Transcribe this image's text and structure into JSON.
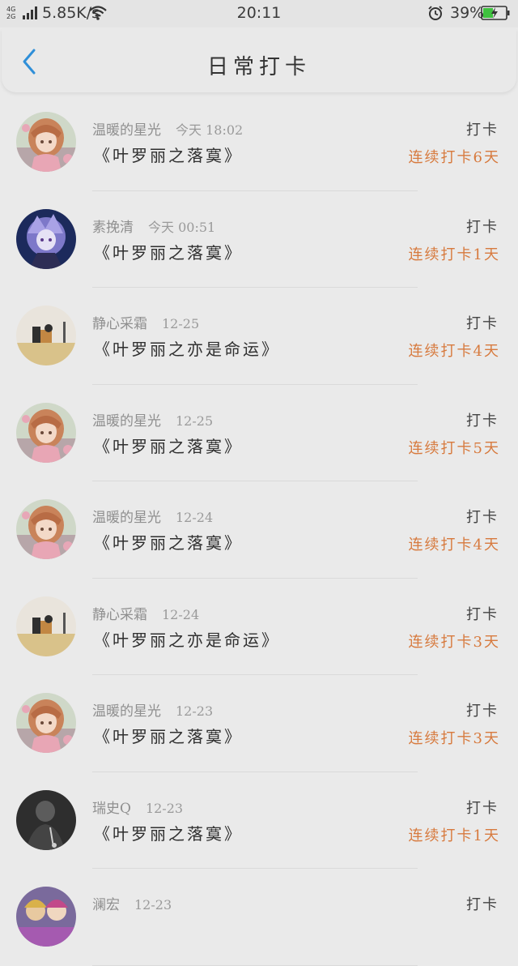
{
  "status_bar": {
    "network_top": "4G",
    "network_bottom": "2G",
    "speed": "5.85K/s",
    "time": "20:11",
    "battery": "39%"
  },
  "header": {
    "title": "日常打卡",
    "back_icon": "chevron-left-icon"
  },
  "colors": {
    "accent": "#2f8fd8",
    "streak": "#d77a3e"
  },
  "entries": [
    {
      "name": "温暖的星光",
      "date": "今天 18:02",
      "book": "《叶罗丽之落寞》",
      "checkin": "打卡",
      "streak": "连续打卡6天",
      "avatar": "anime-girl-pink"
    },
    {
      "name": "素挽清",
      "date": "今天 00:51",
      "book": "《叶罗丽之落寞》",
      "checkin": "打卡",
      "streak": "连续打卡1天",
      "avatar": "anime-purple"
    },
    {
      "name": "静心采霜",
      "date": "12-25",
      "book": "《叶罗丽之亦是命运》",
      "checkin": "打卡",
      "streak": "连续打卡4天",
      "avatar": "cat-photo"
    },
    {
      "name": "温暖的星光",
      "date": "12-25",
      "book": "《叶罗丽之落寞》",
      "checkin": "打卡",
      "streak": "连续打卡5天",
      "avatar": "anime-girl-pink"
    },
    {
      "name": "温暖的星光",
      "date": "12-24",
      "book": "《叶罗丽之落寞》",
      "checkin": "打卡",
      "streak": "连续打卡4天",
      "avatar": "anime-girl-pink"
    },
    {
      "name": "静心采霜",
      "date": "12-24",
      "book": "《叶罗丽之亦是命运》",
      "checkin": "打卡",
      "streak": "连续打卡3天",
      "avatar": "cat-photo"
    },
    {
      "name": "温暖的星光",
      "date": "12-23",
      "book": "《叶罗丽之落寞》",
      "checkin": "打卡",
      "streak": "连续打卡3天",
      "avatar": "anime-girl-pink"
    },
    {
      "name": "瑞史Q",
      "date": "12-23",
      "book": "《叶罗丽之落寞》",
      "checkin": "打卡",
      "streak": "连续打卡1天",
      "avatar": "dark-photo"
    },
    {
      "name": "澜宏",
      "date": "12-23",
      "book": "",
      "checkin": "打卡",
      "streak": "",
      "avatar": "anime-group"
    }
  ]
}
